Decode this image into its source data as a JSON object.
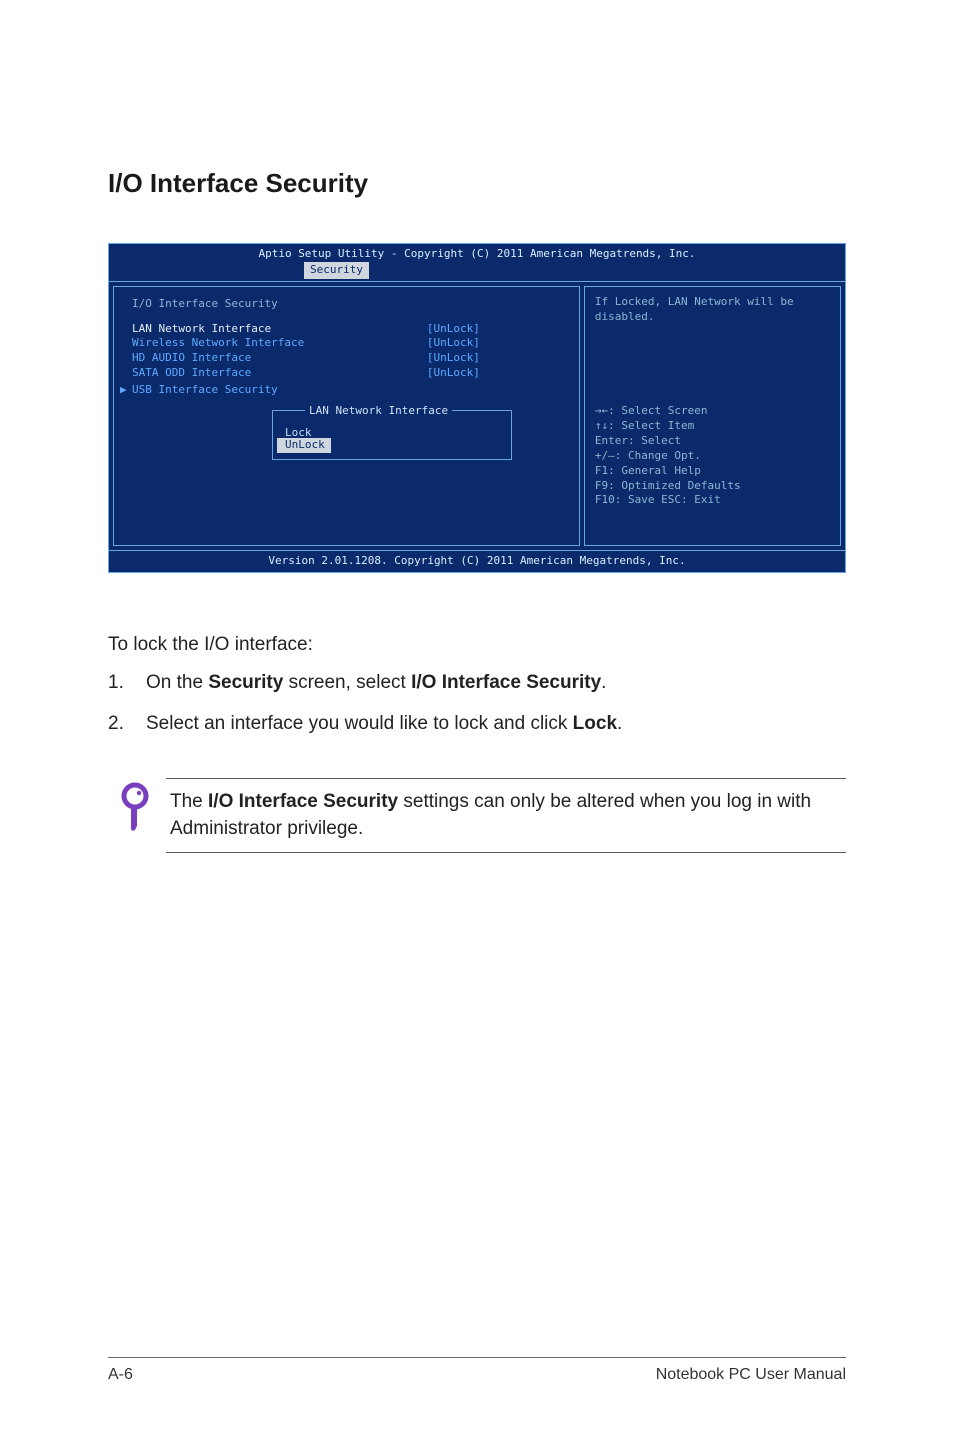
{
  "heading": "I/O Interface Security",
  "bios": {
    "utility_title": "Aptio Setup Utility - Copyright (C) 2011 American Megatrends, Inc.",
    "active_tab": "Security",
    "section_title": "I/O Interface Security",
    "items": [
      {
        "label": "LAN Network Interface",
        "value": "[UnLock]",
        "selected": true
      },
      {
        "label": "Wireless Network Interface",
        "value": "[UnLock]",
        "selected": false
      },
      {
        "label": "HD AUDIO Interface",
        "value": "[UnLock]",
        "selected": false
      },
      {
        "label": "SATA ODD Interface",
        "value": "[UnLock]",
        "selected": false
      }
    ],
    "submenu_label": "USB Interface Security",
    "popup": {
      "title": "LAN Network Interface",
      "options": [
        "Lock",
        "UnLock"
      ],
      "selected": "UnLock"
    },
    "help_text": "If Locked, LAN Network will be disabled.",
    "nav": {
      "l0": "→←: Select Screen",
      "l1": "↑↓:   Select Item",
      "l2": "Enter: Select",
      "l3": "+/—:  Change Opt.",
      "l4": "F1:   General Help",
      "l5": "F9:   Optimized Defaults",
      "l6": "F10:  Save   ESC: Exit"
    },
    "footer": "Version 2.01.1208. Copyright (C) 2011 American Megatrends, Inc."
  },
  "body": {
    "intro": "To lock the I/O interface:",
    "step1_num": "1.",
    "step1_a": "On the ",
    "step1_b": "Security",
    "step1_c": " screen, select ",
    "step1_d": "I/O Interface Security",
    "step1_e": ".",
    "step2_num": "2.",
    "step2_a": "Select an interface you would like to lock and click ",
    "step2_b": "Lock",
    "step2_c": "."
  },
  "note": {
    "a": "The ",
    "b": "I/O Interface Security",
    "c": " settings can only be altered when you log in with Administrator privilege."
  },
  "footer": {
    "left": "A-6",
    "right": "Notebook PC User Manual"
  }
}
